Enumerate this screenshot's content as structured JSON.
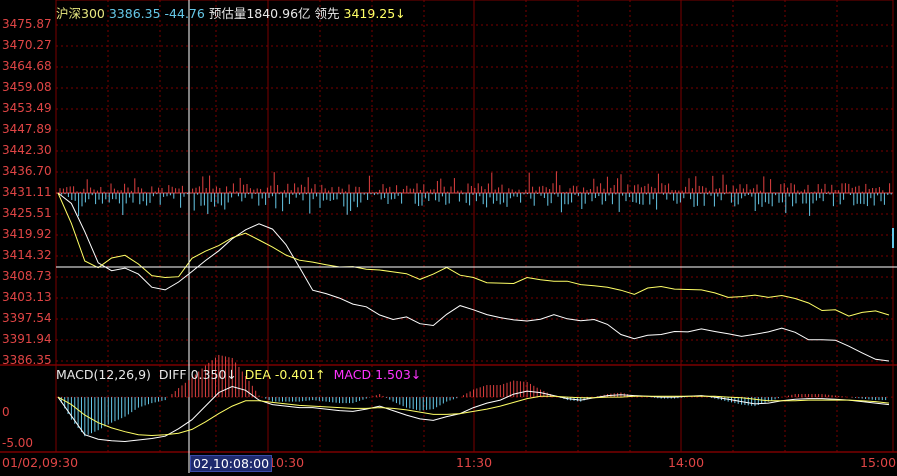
{
  "header": {
    "name": "沪深300",
    "price": "3386.35",
    "change": "-44.76",
    "volume_label": "预估量",
    "volume_value": "1840.96亿",
    "lead_label": "领先",
    "lead_value": "3419.25↓"
  },
  "macd": {
    "label": "MACD(12,26,9)",
    "diff_label": "DIFF",
    "diff_value": "0.350↓",
    "dea_label": "DEA",
    "dea_value": "-0.401↑",
    "macd_label": "MACD",
    "macd_value": "1.503↓",
    "y_labels": [
      "0",
      "-5.00"
    ]
  },
  "price_axis_labels": [
    "3475.87",
    "3470.27",
    "3464.68",
    "3459.08",
    "3453.49",
    "3447.89",
    "3442.30",
    "3436.70",
    "3431.11",
    "3425.51",
    "3419.92",
    "3414.32",
    "3408.73",
    "3403.13",
    "3397.54",
    "3391.94",
    "3386.35"
  ],
  "time_axis": {
    "labels": [
      "01/02,09:30",
      "10:30",
      "11:30",
      "14:00",
      "15:00"
    ],
    "crosshair_label": "02,10:08:00"
  },
  "colors": {
    "background": "#000000",
    "grid": "#7a0000",
    "axis_text": "#e04545",
    "price_line": "#ffffff",
    "lead_line": "#ffff66",
    "up_bar": "#e04040",
    "down_bar": "#66c8e8",
    "diff_line": "#ffffff",
    "dea_line": "#ffff66",
    "macd_label": "#ff33ff"
  },
  "chart_data": {
    "type": "line",
    "series": [
      {
        "name": "沪深300",
        "values": [
          3431.11,
          3428.3,
          3420.8,
          3412.5,
          3410.4,
          3411.1,
          3409.5,
          3406.0,
          3405.3,
          3407.4,
          3410.2,
          3413.1,
          3415.7,
          3418.9,
          3421.3,
          3422.9,
          3421.5,
          3417.4,
          3411.4,
          3405.2,
          3404.3,
          3403.1,
          3401.5,
          3400.8,
          3398.6,
          3397.4,
          3398.1,
          3396.3,
          3395.8,
          3398.8,
          3401.1,
          3400.0,
          3398.7,
          3397.9,
          3397.3,
          3397.0,
          3397.5,
          3398.7,
          3397.6,
          3397.1,
          3397.4,
          3396.1,
          3393.4,
          3392.3,
          3393.2,
          3393.4,
          3394.2,
          3394.1,
          3394.9,
          3394.2,
          3393.6,
          3392.9,
          3393.5,
          3394.1,
          3395.1,
          3394.0,
          3392.0,
          3392.0,
          3391.9,
          3390.3,
          3388.5,
          3386.8,
          3386.35
        ]
      },
      {
        "name": "领先",
        "values": [
          3431.11,
          3423.0,
          3413.0,
          3411.2,
          3413.8,
          3414.5,
          3412.2,
          3409.1,
          3408.6,
          3408.8,
          3413.7,
          3415.6,
          3417.1,
          3419.2,
          3420.4,
          3418.6,
          3416.7,
          3414.6,
          3413.2,
          3412.7,
          3412.0,
          3411.4,
          3411.5,
          3410.8,
          3410.6,
          3410.1,
          3409.6,
          3408.1,
          3409.5,
          3411.3,
          3409.2,
          3408.6,
          3407.2,
          3407.1,
          3407.0,
          3408.6,
          3408.0,
          3407.6,
          3407.6,
          3406.7,
          3406.4,
          3406.0,
          3405.2,
          3404.1,
          3405.8,
          3406.2,
          3405.5,
          3405.4,
          3405.3,
          3404.5,
          3403.3,
          3403.5,
          3403.9,
          3403.3,
          3403.8,
          3403.0,
          3401.8,
          3399.8,
          3400.0,
          3398.3,
          3399.3,
          3399.7,
          3398.6
        ]
      }
    ],
    "ylim": [
      3386.35,
      3475.87
    ],
    "grid": true,
    "macd_panel": {
      "ylim": [
        -6.5,
        3.2
      ],
      "diff": [
        0,
        -2.5,
        -5.0,
        -5.6,
        -5.8,
        -5.9,
        -5.7,
        -5.5,
        -5.2,
        -4.2,
        -3.0,
        -1.2,
        0.6,
        1.4,
        0.9,
        -0.4,
        -1.0,
        -1.2,
        -1.4,
        -1.4,
        -1.6,
        -1.8,
        -1.9,
        -1.6,
        -1.2,
        -1.8,
        -2.4,
        -2.9,
        -3.1,
        -2.6,
        -2.2,
        -1.4,
        -0.8,
        -0.4,
        0.4,
        0.8,
        0.6,
        0.2,
        -0.2,
        -0.4,
        -0.1,
        0.2,
        0.3,
        0.2,
        0.1,
        0.0,
        0.0,
        0.1,
        0.2,
        0.0,
        -0.3,
        -0.6,
        -0.9,
        -0.8,
        -0.5,
        -0.3,
        -0.2,
        -0.2,
        -0.3,
        -0.4,
        -0.6,
        -0.8,
        -1.0
      ],
      "dea": [
        0,
        -1.0,
        -2.4,
        -3.4,
        -4.1,
        -4.6,
        -5.0,
        -5.1,
        -5.0,
        -4.8,
        -4.3,
        -3.3,
        -2.2,
        -1.2,
        -0.5,
        -0.5,
        -0.7,
        -0.9,
        -1.1,
        -1.2,
        -1.3,
        -1.4,
        -1.5,
        -1.5,
        -1.4,
        -1.5,
        -1.7,
        -2.0,
        -2.3,
        -2.3,
        -2.2,
        -1.9,
        -1.6,
        -1.2,
        -0.7,
        -0.2,
        0.1,
        0.1,
        0.0,
        -0.1,
        -0.1,
        0.0,
        0.0,
        0.1,
        0.1,
        0.1,
        0.1,
        0.1,
        0.1,
        0.1,
        0.0,
        -0.1,
        -0.3,
        -0.5,
        -0.5,
        -0.5,
        -0.4,
        -0.4,
        -0.4,
        -0.4,
        -0.5,
        -0.6,
        -0.8
      ]
    }
  }
}
